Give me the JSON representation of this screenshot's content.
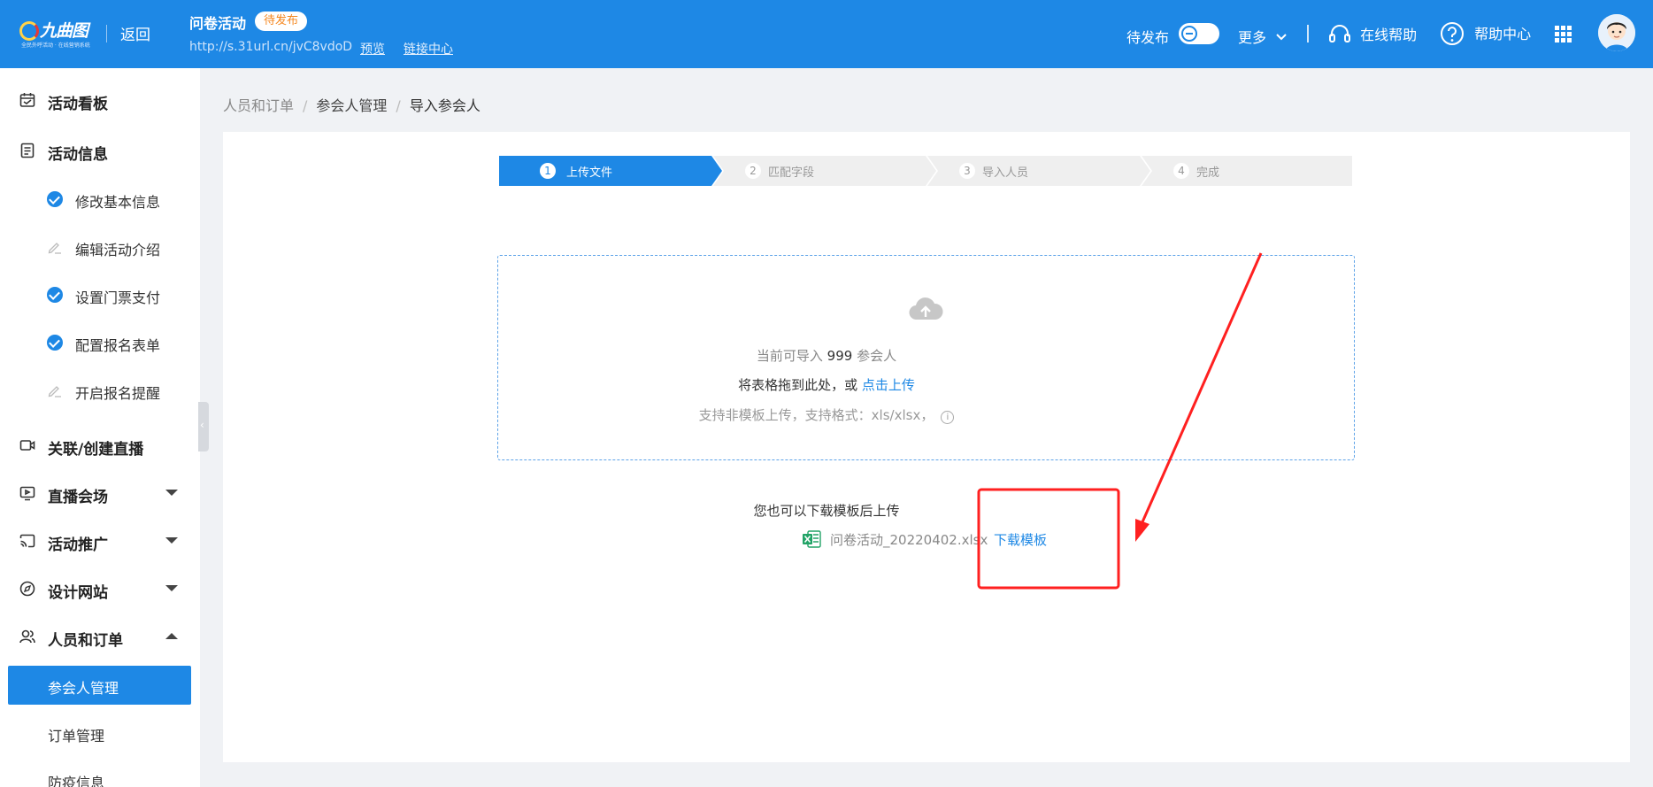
{
  "header": {
    "logo_text": "九曲图",
    "logo_sub": "全民外呼活动 · 在线营销系统",
    "back": "返回",
    "event_title": "问卷活动",
    "status_badge": "待发布",
    "event_url": "http://s.31url.cn/jvC8vdoD",
    "preview": "预览",
    "link_center": "链接中心",
    "publish_label": "待发布",
    "more": "更多",
    "online_help": "在线帮助",
    "help_center": "帮助中心"
  },
  "sidebar": {
    "items": [
      {
        "label": "活动看板"
      },
      {
        "label": "活动信息"
      },
      {
        "label": "修改基本信息",
        "state": "done"
      },
      {
        "label": "编辑活动介绍",
        "state": "todo"
      },
      {
        "label": "设置门票支付",
        "state": "done"
      },
      {
        "label": "配置报名表单",
        "state": "done"
      },
      {
        "label": "开启报名提醒",
        "state": "todo"
      },
      {
        "label": "关联/创建直播"
      },
      {
        "label": "直播会场"
      },
      {
        "label": "活动推广"
      },
      {
        "label": "设计网站"
      },
      {
        "label": "人员和订单"
      },
      {
        "label": "参会人管理",
        "active": true
      },
      {
        "label": "订单管理"
      },
      {
        "label": "防疫信息"
      }
    ]
  },
  "breadcrumb": [
    "人员和订单",
    "参会人管理",
    "导入参会人"
  ],
  "steps": [
    {
      "num": "1",
      "label": "上传文件",
      "active": true
    },
    {
      "num": "2",
      "label": "匹配字段"
    },
    {
      "num": "3",
      "label": "导入人员"
    },
    {
      "num": "4",
      "label": "完成"
    }
  ],
  "upload": {
    "quota_prefix": "当前可导入",
    "quota_value": "999",
    "quota_suffix": "参会人",
    "drag_text": "将表格拖到此处，或",
    "click_upload": "点击上传",
    "formats": "支持非模板上传，支持格式：xls/xlsx，",
    "info_glyph": "i"
  },
  "template": {
    "hint": "您也可以下载模板后上传",
    "file_name": "问卷活动_20220402.xlsx",
    "download": "下载模板"
  },
  "colors": {
    "primary": "#1e88e5",
    "badge_text": "#f5871f",
    "annotation": "#ff2020"
  }
}
